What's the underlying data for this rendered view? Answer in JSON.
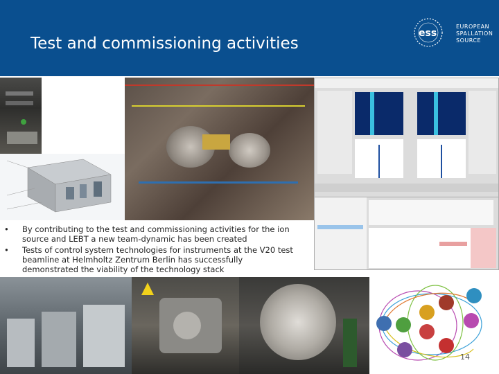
{
  "header": {
    "title": "Test and commissioning activities",
    "logo": {
      "mark": "ess",
      "lines": [
        "EUROPEAN",
        "SPALLATION",
        "SOURCE"
      ]
    },
    "background_color": "#0a4f8f"
  },
  "bullets": [
    "By contributing to the test and commissioning activities for the ion source and LEBT a new team-dynamic has been created",
    "Tests of control system technologies for instruments at the V20 test beamline at Helmholtz Zentrum Berlin has successfully demonstrated the viability of the technology stack"
  ],
  "bullet_marker": "•",
  "page_number": "14"
}
